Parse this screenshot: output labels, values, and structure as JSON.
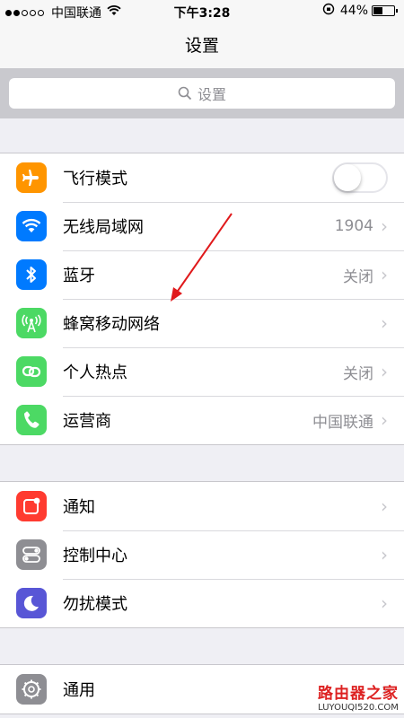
{
  "status": {
    "carrier": "中国联通",
    "time": "下午3:28",
    "battery": "44%",
    "battery_level": 0.44
  },
  "nav": {
    "title": "设置"
  },
  "search": {
    "placeholder": "设置"
  },
  "groups": [
    [
      {
        "label": "飞行模式",
        "icon": "airplane-icon",
        "color": "#ff9500",
        "toggle": false
      },
      {
        "label": "无线局域网",
        "value": "1904",
        "icon": "wifi-icon",
        "color": "#007aff"
      },
      {
        "label": "蓝牙",
        "value": "关闭",
        "icon": "bluetooth-icon",
        "color": "#007aff"
      },
      {
        "label": "蜂窝移动网络",
        "value": "",
        "icon": "cellular-icon",
        "color": "#4cd964"
      },
      {
        "label": "个人热点",
        "value": "关闭",
        "icon": "hotspot-icon",
        "color": "#4cd964"
      },
      {
        "label": "运营商",
        "value": "中国联通",
        "icon": "phone-icon",
        "color": "#4cd964"
      }
    ],
    [
      {
        "label": "通知",
        "icon": "notification-icon",
        "color": "#ff3b30"
      },
      {
        "label": "控制中心",
        "icon": "control-center-icon",
        "color": "#8e8e93"
      },
      {
        "label": "勿扰模式",
        "icon": "moon-icon",
        "color": "#5856d6"
      }
    ],
    [
      {
        "label": "通用",
        "icon": "gear-icon",
        "color": "#8e8e93"
      }
    ]
  ],
  "watermark": {
    "title": "路由器之家",
    "url": "LUYOUQI520.COM"
  }
}
